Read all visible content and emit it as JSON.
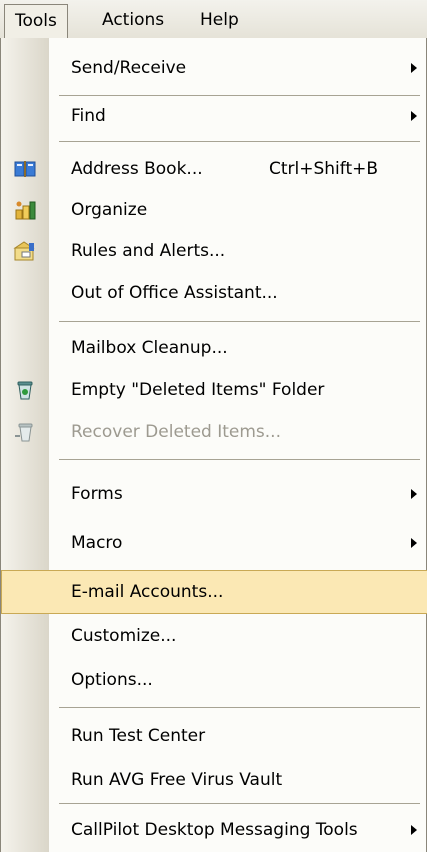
{
  "menubar": {
    "tools": "Tools",
    "actions": "Actions",
    "help": "Help"
  },
  "menu": {
    "items": [
      {
        "label": "Send/Receive",
        "submenu": true
      },
      {
        "label": "Find",
        "submenu": true
      },
      {
        "label": "Address Book...",
        "shortcut": "Ctrl+Shift+B",
        "icon": "address-book-icon"
      },
      {
        "label": "Organize",
        "icon": "organize-icon"
      },
      {
        "label": "Rules and Alerts...",
        "icon": "rules-icon"
      },
      {
        "label": "Out of Office Assistant..."
      },
      {
        "label": "Mailbox Cleanup..."
      },
      {
        "label": "Empty \"Deleted Items\" Folder",
        "icon": "trash-icon"
      },
      {
        "label": "Recover Deleted Items...",
        "icon": "recover-icon",
        "disabled": true
      },
      {
        "label": "Forms",
        "submenu": true
      },
      {
        "label": "Macro",
        "submenu": true
      },
      {
        "label": "E-mail Accounts...",
        "highlighted": true
      },
      {
        "label": "Customize..."
      },
      {
        "label": "Options..."
      },
      {
        "label": "Run Test Center"
      },
      {
        "label": "Run AVG Free Virus Vault"
      },
      {
        "label": "CallPilot Desktop Messaging Tools",
        "submenu": true
      }
    ]
  },
  "colors": {
    "highlight": "#fbe8b4",
    "highlight_border": "#c9a955",
    "disabled_text": "#9d9a90"
  }
}
